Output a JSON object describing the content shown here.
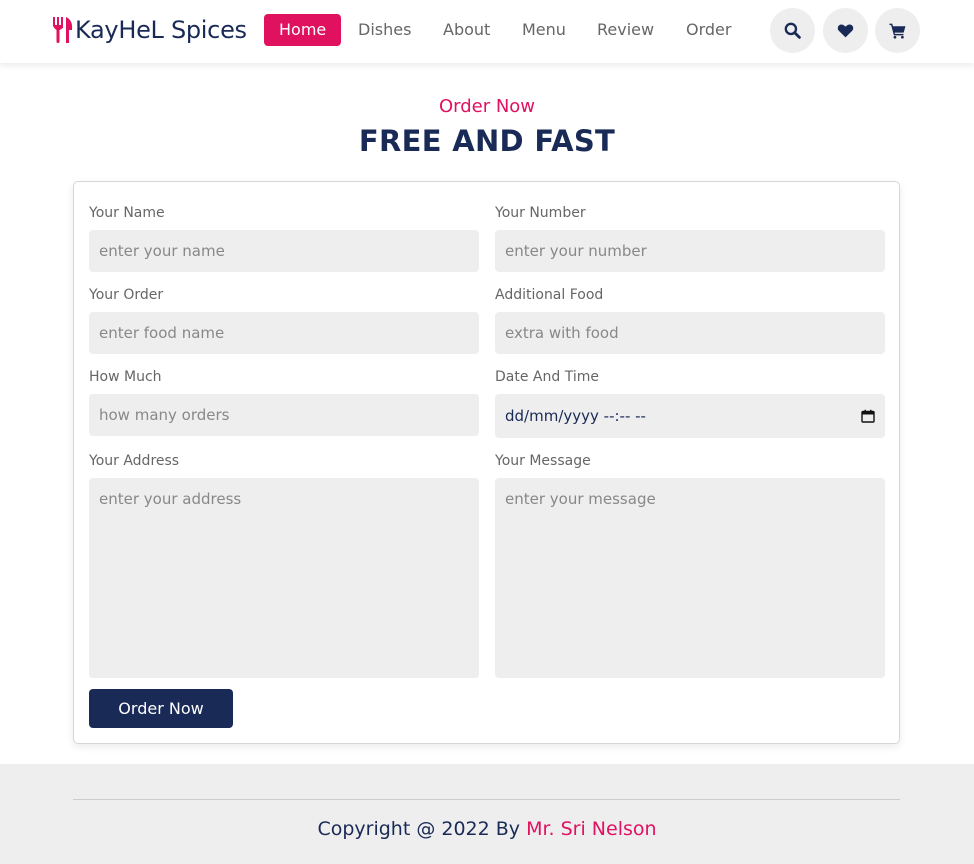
{
  "header": {
    "brand": "KayHeL Spices",
    "nav": [
      {
        "label": "Home",
        "active": true
      },
      {
        "label": "Dishes",
        "active": false
      },
      {
        "label": "About",
        "active": false
      },
      {
        "label": "Menu",
        "active": false
      },
      {
        "label": "Review",
        "active": false
      },
      {
        "label": "Order",
        "active": false
      }
    ],
    "icons": [
      "search-icon",
      "heart-icon",
      "cart-icon"
    ]
  },
  "section": {
    "subheading": "Order Now",
    "heading": "FREE AND FAST"
  },
  "form": {
    "fields": [
      {
        "label": "Your Name",
        "placeholder": "enter your name"
      },
      {
        "label": "Your Number",
        "placeholder": "enter your number"
      },
      {
        "label": "Your Order",
        "placeholder": "enter food name"
      },
      {
        "label": "Additional Food",
        "placeholder": "extra with food"
      },
      {
        "label": "How Much",
        "placeholder": "how many orders"
      },
      {
        "label": "Date And Time",
        "placeholder": "dd/mm/yyyy --:-- --"
      },
      {
        "label": "Your Address",
        "placeholder": "enter your address"
      },
      {
        "label": "Your Message",
        "placeholder": "enter your message"
      }
    ],
    "submit_label": "Order Now"
  },
  "footer": {
    "copyright": "Copyright @ 2022 By",
    "author": "Mr. Sri Nelson"
  },
  "colors": {
    "accent": "#e0115f",
    "primary": "#192a56",
    "input_bg": "#eeeeee"
  }
}
